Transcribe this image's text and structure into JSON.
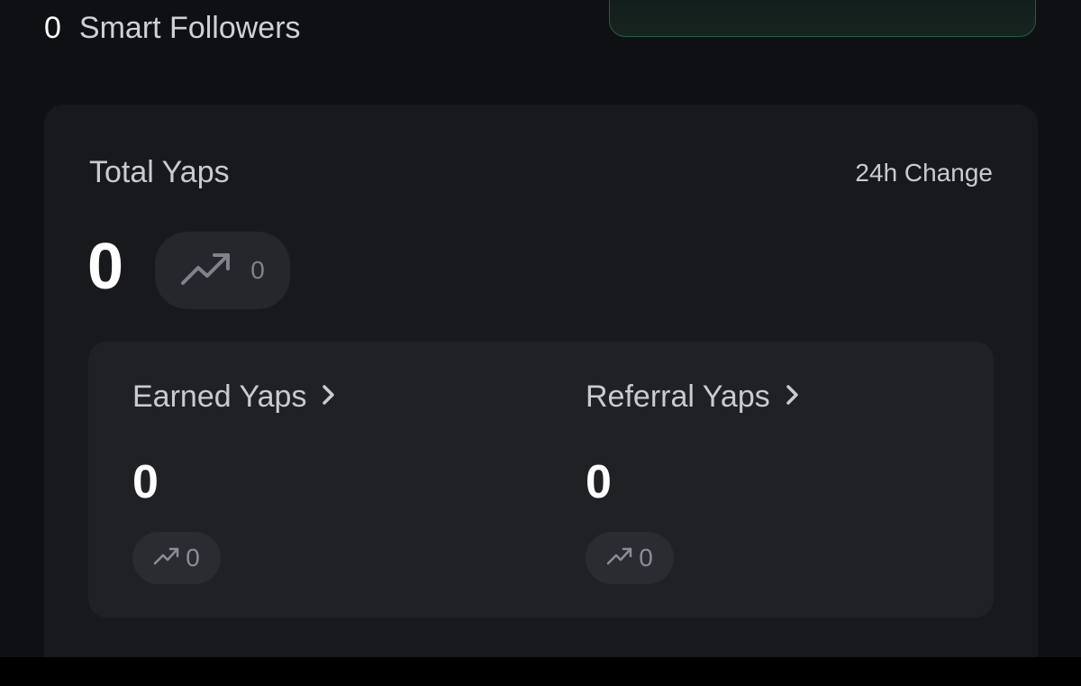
{
  "profile": {
    "smart_followers_count": "0",
    "smart_followers_label": "Smart Followers"
  },
  "total_yaps": {
    "label": "Total Yaps",
    "change_label": "24h Change",
    "value": "0",
    "change_value": "0",
    "trend_icon": "trending-up-icon"
  },
  "breakdown": {
    "earned": {
      "label": "Earned Yaps",
      "value": "0",
      "change_value": "0",
      "chevron_icon": "chevron-right-icon",
      "trend_icon": "trending-up-icon"
    },
    "referral": {
      "label": "Referral Yaps",
      "value": "0",
      "change_value": "0",
      "chevron_icon": "chevron-right-icon",
      "trend_icon": "trending-up-icon"
    }
  },
  "colors": {
    "background": "#0f1013",
    "card": "#18191d",
    "sub_card": "#1f2125",
    "accent_border": "#2a5a4a"
  }
}
